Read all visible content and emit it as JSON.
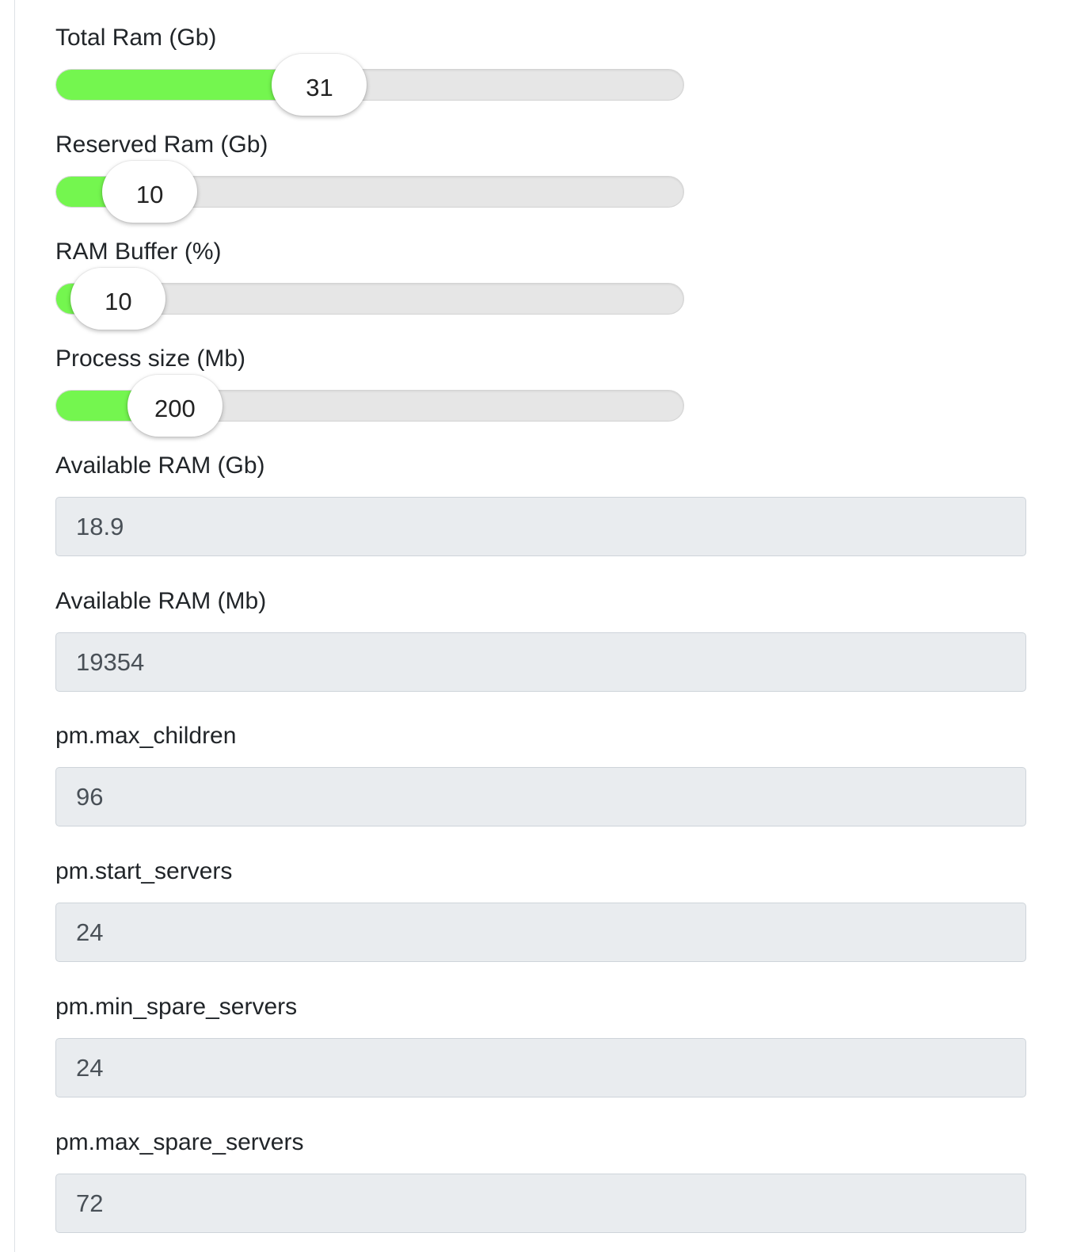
{
  "sliders": [
    {
      "label": "Total Ram (Gb)",
      "value": "31",
      "fill_fraction": 0.42
    },
    {
      "label": "Reserved Ram (Gb)",
      "value": "10",
      "fill_fraction": 0.15
    },
    {
      "label": "RAM Buffer (%)",
      "value": "10",
      "fill_fraction": 0.1
    },
    {
      "label": "Process size (Mb)",
      "value": "200",
      "fill_fraction": 0.19
    }
  ],
  "fields": [
    {
      "label": "Available RAM (Gb)",
      "value": "18.9"
    },
    {
      "label": "Available RAM (Mb)",
      "value": "19354"
    },
    {
      "label": "pm.max_children",
      "value": "96"
    },
    {
      "label": "pm.start_servers",
      "value": "24"
    },
    {
      "label": "pm.min_spare_servers",
      "value": "24"
    },
    {
      "label": "pm.max_spare_servers",
      "value": "72"
    }
  ],
  "colors": {
    "slider_fill": "#74f64f",
    "track": "#e6e6e6",
    "readonly_input_bg": "#e9ecef"
  }
}
